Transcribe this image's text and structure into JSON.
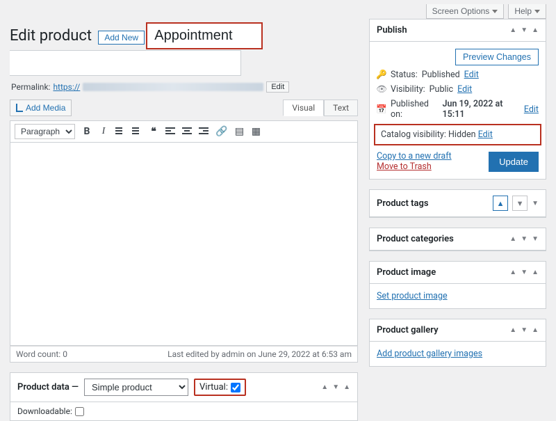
{
  "topbar": {
    "screen_options": "Screen Options",
    "help": "Help"
  },
  "heading": {
    "title": "Edit product",
    "add_new": "Add New"
  },
  "post": {
    "title_value": "Appointment",
    "permalink_label": "Permalink:",
    "permalink_prefix": "https://",
    "permalink_edit": "Edit"
  },
  "editor": {
    "add_media": "Add Media",
    "tab_visual": "Visual",
    "tab_text": "Text",
    "paragraph": "Paragraph",
    "word_count_label": "Word count:",
    "word_count_value": "0",
    "last_edited": "Last edited by admin on June 29, 2022 at 6:53 am"
  },
  "product_data": {
    "heading": "Product data",
    "type_value": "Simple product",
    "virtual_label": "Virtual:",
    "virtual_checked": true,
    "downloadable_label": "Downloadable:",
    "downloadable_checked": false
  },
  "publish": {
    "box_title": "Publish",
    "preview_changes": "Preview Changes",
    "status_label": "Status:",
    "status_value": "Published",
    "status_edit": "Edit",
    "visibility_label": "Visibility:",
    "visibility_value": "Public",
    "visibility_edit": "Edit",
    "published_label": "Published on:",
    "published_value": "Jun 19, 2022 at 15:11",
    "published_edit": "Edit",
    "catalog_label": "Catalog visibility:",
    "catalog_value": "Hidden",
    "catalog_edit": "Edit",
    "copy_draft": "Copy to a new draft",
    "move_trash": "Move to Trash",
    "update": "Update"
  },
  "sideboxes": {
    "tags": "Product tags",
    "categories": "Product categories",
    "image_title": "Product image",
    "image_link": "Set product image",
    "gallery_title": "Product gallery",
    "gallery_link": "Add product gallery images"
  }
}
